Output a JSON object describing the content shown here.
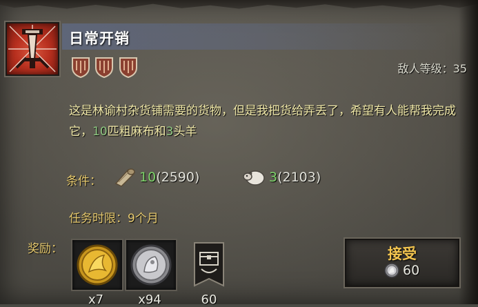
{
  "quest": {
    "icon": "sword-crest-icon",
    "title": "日常开销",
    "difficulty_shields": 3,
    "enemy_level_label": "敌人等级：",
    "enemy_level_value": "35",
    "description_part1": "这是林谕村杂货铺需要的货物，但是我把货给弄丢了，希望有人能帮我完成它，",
    "description_num1": "10",
    "description_part2": "匹粗麻布和",
    "description_num2": "3",
    "description_part3": "头羊"
  },
  "conditions": {
    "label": "条件：",
    "items": [
      {
        "icon": "cloth-roll-icon",
        "required": "10",
        "owned": "(2590)"
      },
      {
        "icon": "sheep-icon",
        "required": "3",
        "owned": "(2103)"
      }
    ]
  },
  "time_limit": "任务时限：9个月",
  "rewards": {
    "label": "奖励：",
    "items": [
      {
        "icon": "gold-coin-icon",
        "count": "x7"
      },
      {
        "icon": "silver-coin-icon",
        "count": "x94"
      },
      {
        "icon": "chest-banner-icon",
        "count": "60"
      }
    ]
  },
  "accept": {
    "label": "接受",
    "cost_icon": "silver-coin-icon",
    "cost": "60"
  },
  "colors": {
    "description": "#f0e8a8",
    "highlight_green": "#7ed36a",
    "gold_label": "#e6c96e",
    "accept_text": "#f2c44f"
  }
}
